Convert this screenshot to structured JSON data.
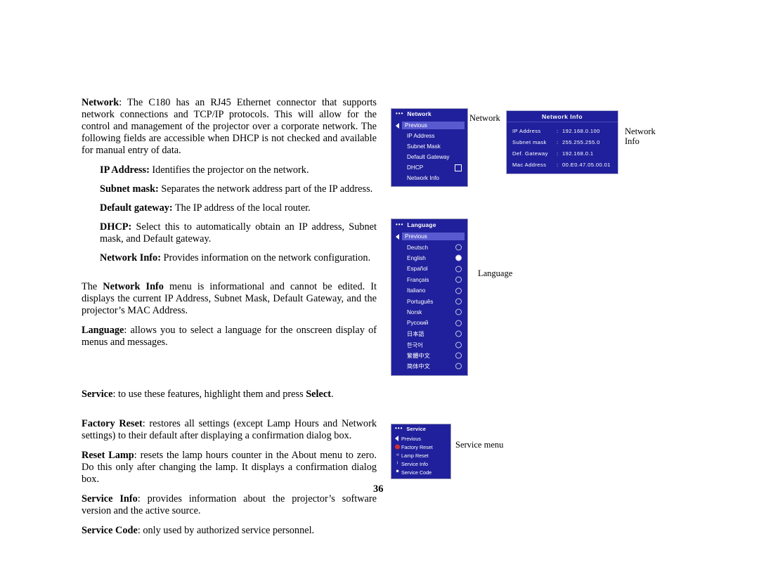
{
  "page": {
    "number": "36"
  },
  "body": {
    "p1": {
      "lead": "Network",
      "text": ": The C180 has an RJ45 Ethernet connector that supports network connections and TCP/IP protocols. This will allow for the control and management of the projector over a corporate network. The following fields are accessible when DHCP is not checked and available for manual entry of data."
    },
    "p2": {
      "lead": "IP Address:",
      "text": " Identifies the projector on the network."
    },
    "p3": {
      "lead": "Subnet mask:",
      "text": " Separates the network address part of the IP address."
    },
    "p4": {
      "lead": "Default gateway:",
      "text": " The IP address of the local router."
    },
    "p5": {
      "lead": "DHCP:",
      "text": " Select this to automatically obtain an IP address, Subnet mask, and Default gateway."
    },
    "p6": {
      "lead": "Network Info:",
      "text": " Provides information on the network configuration."
    },
    "p7": {
      "pre": "The ",
      "lead": "Network Info",
      "text": " menu is informational and cannot be edited. It displays the current IP Address, Subnet Mask, Default Gateway, and the projector’s MAC Address."
    },
    "p8": {
      "lead": "Language",
      "text": ": allows you to select a language for the onscreen display of menus and messages."
    },
    "p9": {
      "lead": "Service",
      "text": ": to use these features, highlight them and press ",
      "lead2": "Select",
      "tail": "."
    },
    "p10": {
      "lead": "Factory Reset",
      "text": ": restores all settings (except Lamp Hours and Network settings) to their default after displaying a confirmation dialog box."
    },
    "p11": {
      "lead": "Reset Lamp",
      "text": ": resets the lamp hours counter in the About menu to zero. Do this only after changing the lamp. It displays a confirmation dialog box."
    },
    "p12": {
      "lead": "Service Info",
      "text": ": provides information about the projector’s software version and the active source."
    },
    "p13": {
      "lead": "Service Code",
      "text": ": only used by authorized service personnel."
    }
  },
  "network_menu": {
    "title": "Network",
    "dots": "•••",
    "previous": "Previous",
    "items": [
      {
        "label": "IP Address",
        "control": "none"
      },
      {
        "label": "Subnet Mask",
        "control": "none"
      },
      {
        "label": "Default Gateway",
        "control": "none"
      },
      {
        "label": "DHCP",
        "control": "checkbox"
      },
      {
        "label": "Network Info",
        "control": "none"
      }
    ]
  },
  "network_info": {
    "title": "Network Info",
    "rows": [
      {
        "key": "IP Address",
        "sep": ":",
        "value": "192.168.0.100"
      },
      {
        "key": "Subnet mask",
        "sep": ":",
        "value": "255.255.255.0"
      },
      {
        "key": "Def. Gateway",
        "sep": ":",
        "value": "192.168.0.1"
      },
      {
        "key": "Mac Address",
        "sep": ":",
        "value": "00.E0.47.05.00.01"
      }
    ]
  },
  "language_menu": {
    "title": "Language",
    "dots": "•••",
    "previous": "Previous",
    "items": [
      {
        "label": "Deutsch",
        "selected": false
      },
      {
        "label": "English",
        "selected": true
      },
      {
        "label": "Español",
        "selected": false
      },
      {
        "label": "Français",
        "selected": false
      },
      {
        "label": "Italiano",
        "selected": false
      },
      {
        "label": "Português",
        "selected": false
      },
      {
        "label": "Norsk",
        "selected": false
      },
      {
        "label": "Русский",
        "selected": false
      },
      {
        "label": "日本語",
        "selected": false
      },
      {
        "label": "한국어",
        "selected": false
      },
      {
        "label": "繁體中文",
        "selected": false
      },
      {
        "label": "简体中文",
        "selected": false
      }
    ]
  },
  "service_menu": {
    "title": "Service",
    "dots": "•••",
    "previous": "Previous",
    "items": [
      {
        "label": "Factory Reset",
        "icon": "red-dot-icon"
      },
      {
        "label": "Lamp Reset",
        "icon": "lamp-icon"
      },
      {
        "label": "Service Info",
        "icon": "info-icon"
      },
      {
        "label": "Service Code",
        "icon": "wrench-icon"
      }
    ]
  },
  "callouts": {
    "network": "Network",
    "network_info_l1": "Network",
    "network_info_l2": "Info",
    "language": "Language",
    "service": "Service menu"
  },
  "colors": {
    "menu_bg": "#20209c",
    "menu_highlight": "#5a5ad0",
    "menu_border": "#9a9aba",
    "text": "#ffffff"
  }
}
